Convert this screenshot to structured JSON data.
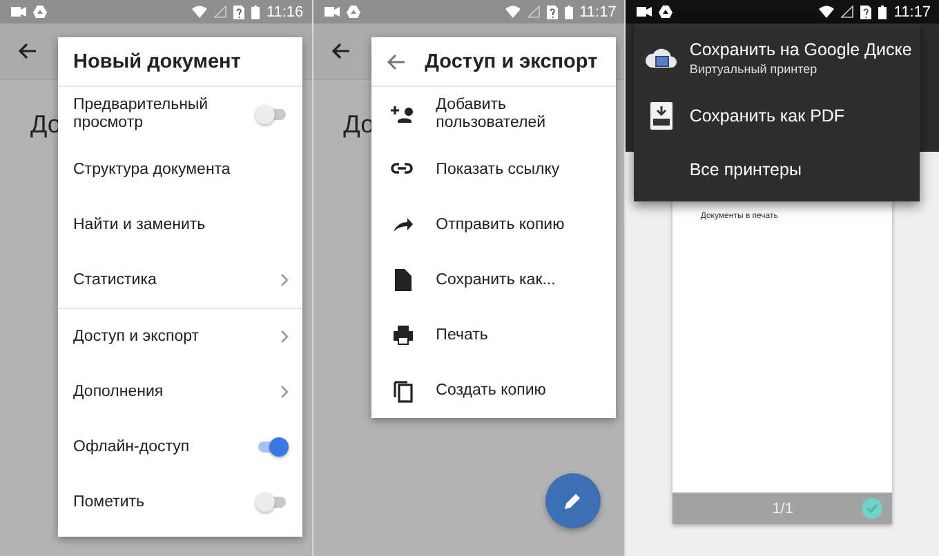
{
  "screens": [
    {
      "kind": "menu",
      "status_bar": {
        "time": "11:16"
      },
      "background_title": "До",
      "fab": false,
      "menu": {
        "title": "Новый документ",
        "back": false,
        "sections": [
          {
            "items": [
              {
                "label": "Предварительный просмотр",
                "kind": "toggle",
                "on": false
              },
              {
                "label": "Структура документа",
                "kind": "plain"
              },
              {
                "label": "Найти и заменить",
                "kind": "plain"
              },
              {
                "label": "Статистика",
                "kind": "submenu"
              }
            ]
          },
          {
            "items": [
              {
                "label": "Доступ и экспорт",
                "kind": "submenu"
              },
              {
                "label": "Дополнения",
                "kind": "submenu"
              },
              {
                "label": "Офлайн-доступ",
                "kind": "toggle",
                "on": true
              },
              {
                "label": "Пометить",
                "kind": "toggle",
                "on": false
              }
            ]
          }
        ]
      }
    },
    {
      "kind": "menu",
      "status_bar": {
        "time": "11:17"
      },
      "background_title": "До",
      "fab": true,
      "menu": {
        "title": "Доступ и экспорт",
        "back": true,
        "sections": [
          {
            "items": [
              {
                "label": "Добавить пользователей",
                "kind": "icon"
              },
              {
                "label": "Показать ссылку",
                "kind": "icon"
              },
              {
                "label": "Отправить копию",
                "kind": "icon"
              },
              {
                "label": "Сохранить как...",
                "kind": "icon"
              },
              {
                "label": "Печать",
                "kind": "icon"
              },
              {
                "label": "Создать копию",
                "kind": "icon"
              }
            ]
          }
        ]
      }
    },
    {
      "kind": "print",
      "status_bar": {
        "time": "11:17"
      },
      "printers": [
        {
          "title": "Сохранить на Google Диске",
          "subtitle": "Виртуальный принтер"
        },
        {
          "title": "Сохранить как PDF"
        },
        {
          "title": "Все принтеры"
        }
      ],
      "preview": {
        "text": "Документы в печать",
        "page": "1/1",
        "selected": true
      }
    }
  ]
}
